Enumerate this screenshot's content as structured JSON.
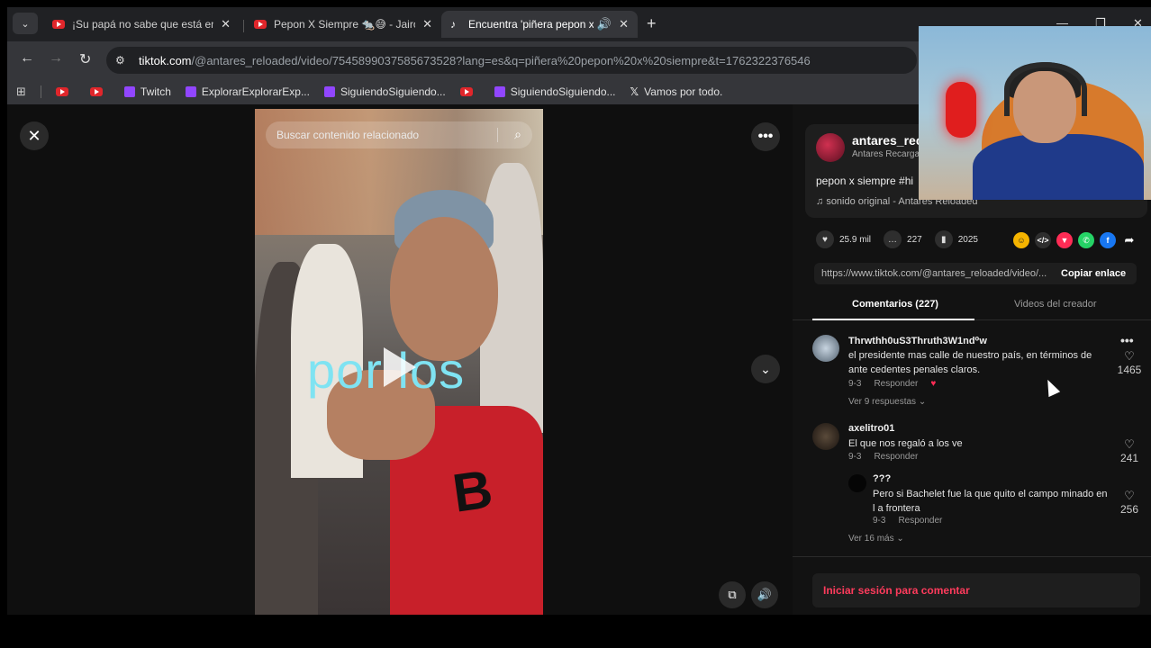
{
  "tabs": [
    {
      "label": "¡Su papá no sabe que está emb",
      "icon": "youtube-icon"
    },
    {
      "label": "Pepon X Siempre 🐀😅 - Jairo V",
      "icon": "youtube-icon"
    },
    {
      "label": "Encuentra 'piñera pepon x s",
      "icon": "tiktok-icon"
    }
  ],
  "address_bar": {
    "host": "tiktok.com",
    "path": "/@antares_reloaded/video/7545899037585673528?lang=es&q=piñera%20pepon%20x%20siempre&t=1762322376546"
  },
  "bookmarks": [
    {
      "label": "",
      "icon": "youtube-icon"
    },
    {
      "label": "",
      "icon": "youtube-icon"
    },
    {
      "label": "Twitch",
      "icon": "twitch-icon"
    },
    {
      "label": "ExplorarExplorarExp...",
      "icon": "twitch-icon"
    },
    {
      "label": "SiguiendoSiguiendo...",
      "icon": "twitch-icon"
    },
    {
      "label": "",
      "icon": "youtube-icon"
    },
    {
      "label": "SiguiendoSiguiendo...",
      "icon": "twitch-icon"
    },
    {
      "label": "Vamos por todo.",
      "icon": "x-icon"
    }
  ],
  "video": {
    "search_placeholder": "Buscar contenido relacionado",
    "caption": "por los"
  },
  "post": {
    "username": "antares_rec",
    "nickname": "Antares Recarga",
    "description": "pepon x siempre #hi",
    "sound": "sonido original - Antares Reloaded",
    "likes": "25.9 mil",
    "comments": "227",
    "saves": "2025",
    "link": "https://www.tiktok.com/@antares_reloaded/video/...",
    "copy_label": "Copiar enlace"
  },
  "comment_tabs": {
    "comments": "Comentarios (227)",
    "creator_videos": "Videos del creador"
  },
  "comments": [
    {
      "user": "Thrwthh0uS3Thruth3W1nd⁰w",
      "text": "el presidente mas calle de nuestro país, en términos de ante cedentes penales claros.",
      "date": "9-3",
      "reply": "Responder",
      "likes": "1465",
      "more": "Ver 9 respuestas"
    },
    {
      "user": "axelitro01",
      "text": "El que nos regaló a los ve",
      "date": "9-3",
      "reply": "Responder",
      "likes": "241"
    },
    {
      "user": "???",
      "text": "Pero si Bachelet fue la que quito el campo minado en l a frontera",
      "date": "9-3",
      "reply": "Responder",
      "likes": "256",
      "more": "Ver 16 más"
    }
  ],
  "login_prompt": "Iniciar sesión para comentar",
  "colors": {
    "accent": "#ff3b5c",
    "youtube": "#e0262b",
    "twitch": "#9146ff"
  }
}
